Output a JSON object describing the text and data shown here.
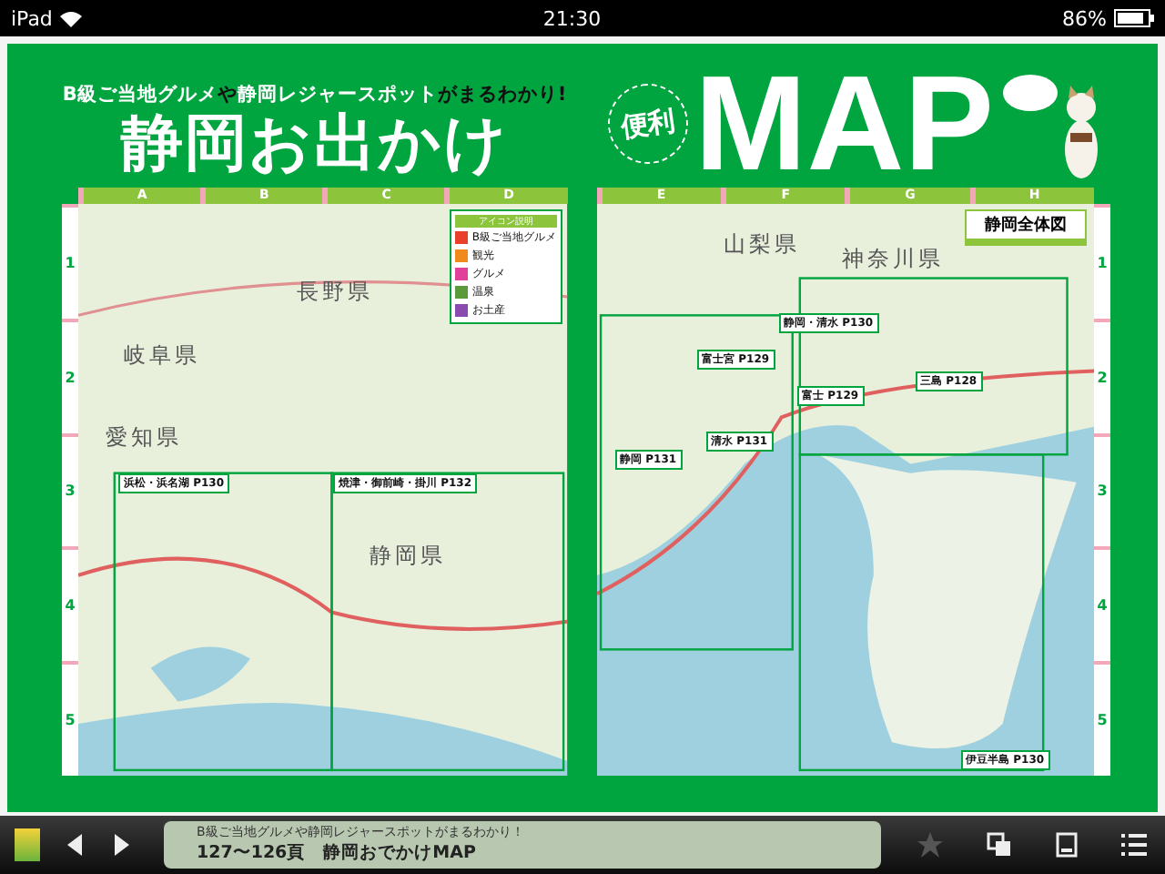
{
  "status_bar": {
    "device": "iPad",
    "time": "21:30",
    "battery": "86%"
  },
  "left_page": {
    "tagline": [
      {
        "text": "B級ご当地グルメ",
        "kind": "highlight"
      },
      {
        "text": "や",
        "kind": "plain"
      },
      {
        "text": "静岡レジャースポット",
        "kind": "highlight"
      },
      {
        "text": "がまるわかり!",
        "kind": "plain"
      }
    ],
    "title": "静岡お出かけ",
    "map": {
      "columns": [
        "A",
        "B",
        "C",
        "D"
      ],
      "rows": [
        "1",
        "2",
        "3",
        "4",
        "5"
      ],
      "regions": [
        "長野県",
        "岐阜県",
        "愛知県",
        "静岡県"
      ],
      "areas": [
        "浜松・浜名湖 P130",
        "焼津・御前崎・掛川 P132"
      ],
      "legend": {
        "title": "アイコン説明",
        "items": [
          {
            "label": "B級ご当地グルメ",
            "color": "#e8402a"
          },
          {
            "label": "観光",
            "color": "#f08a1c"
          },
          {
            "label": "グルメ",
            "color": "#e0409a"
          },
          {
            "label": "温泉",
            "color": "#5a9a3a"
          },
          {
            "label": "お土産",
            "color": "#8a4ab0"
          }
        ]
      }
    }
  },
  "right_page": {
    "badge": "便利",
    "title": "MAP",
    "map": {
      "columns": [
        "E",
        "F",
        "G",
        "H"
      ],
      "rows": [
        "1",
        "2",
        "3",
        "4",
        "5"
      ],
      "regions": [
        "山梨県",
        "神奈川県"
      ],
      "overview": "静岡全体図",
      "areas": [
        "静岡・清水 P130",
        "富士宮 P129",
        "三島 P128",
        "富士 P129",
        "清水 P131",
        "静岡 P131",
        "伊豆半島 P130"
      ]
    }
  },
  "toolbar": {
    "subtitle": "B級ご当地グルメや静岡レジャースポットがまるわかり！",
    "page_title": "127〜126頁　静岡おでかけMAP",
    "bookmarked": false
  }
}
